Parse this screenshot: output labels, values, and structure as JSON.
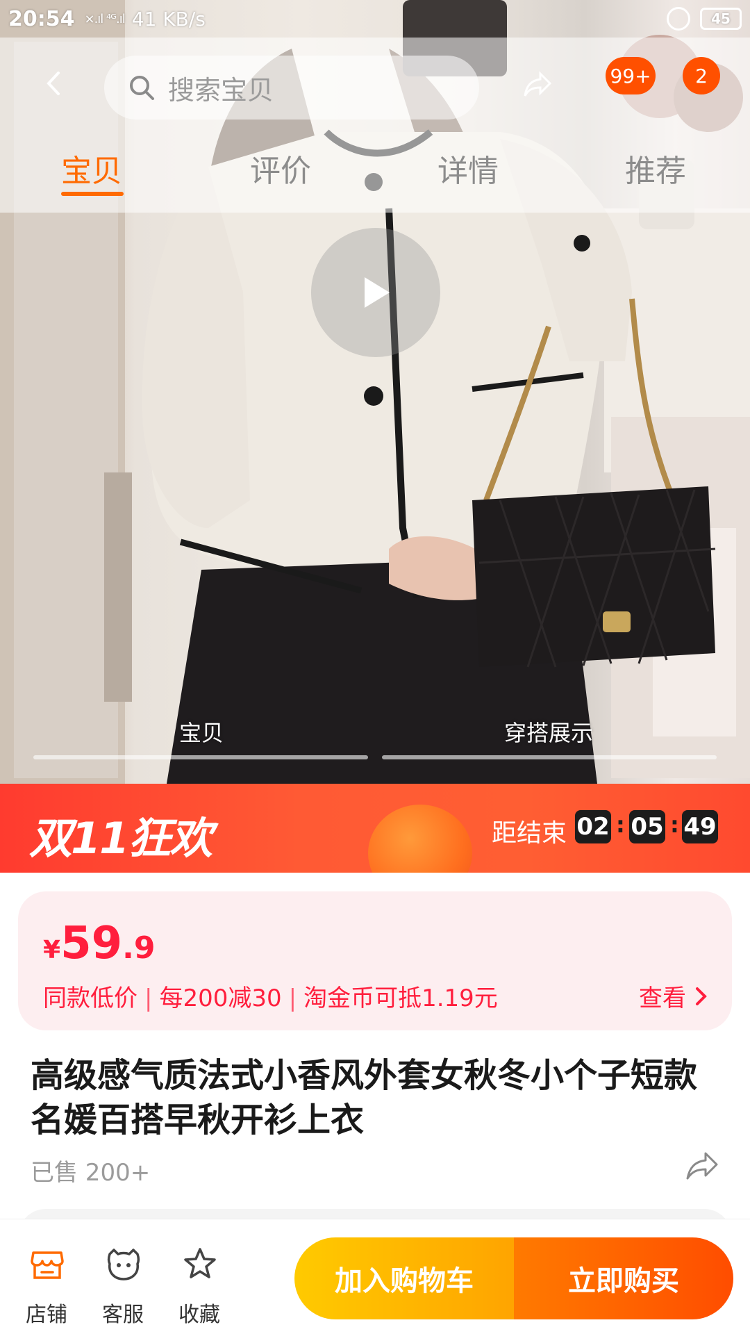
{
  "status_bar": {
    "time": "20:54",
    "signal": "×.ıl ⁴ᴳ.ıl",
    "speed": "41 KB/s",
    "battery": "45"
  },
  "header": {
    "search_placeholder": "搜索宝贝",
    "cart_badge": "99+",
    "message_badge": "2"
  },
  "tabs": [
    {
      "label": "宝贝",
      "active": true
    },
    {
      "label": "评价",
      "active": false
    },
    {
      "label": "详情",
      "active": false
    },
    {
      "label": "推荐",
      "active": false
    }
  ],
  "media_tabs": [
    {
      "label": "宝贝",
      "active": true
    },
    {
      "label": "穿搭展示",
      "active": false
    }
  ],
  "promo": {
    "title": "双11狂欢",
    "ends_label": "距结束",
    "countdown": {
      "hours": "02",
      "minutes": "05",
      "seconds": "49"
    }
  },
  "price": {
    "currency": "¥",
    "integer": "59",
    "decimal": ".9",
    "tags": [
      "同款低价",
      "每200减30",
      "淘金币可抵1.19元"
    ],
    "view_more": "查看"
  },
  "product": {
    "title": "高级感气质法式小香风外套女秋冬小个子短款名媛百搭早秋开衫上衣",
    "sold": "已售 200+"
  },
  "bottom_bar": {
    "shop": "店铺",
    "service": "客服",
    "favorite": "收藏",
    "add_to_cart": "加入购物车",
    "buy_now": "立即购买"
  },
  "colors": {
    "accent": "#ff6a00",
    "price": "#ff1e3d",
    "promo": "#ff4a2f",
    "cart_btn": "#ffb300",
    "buy_btn": "#ff5a00"
  }
}
